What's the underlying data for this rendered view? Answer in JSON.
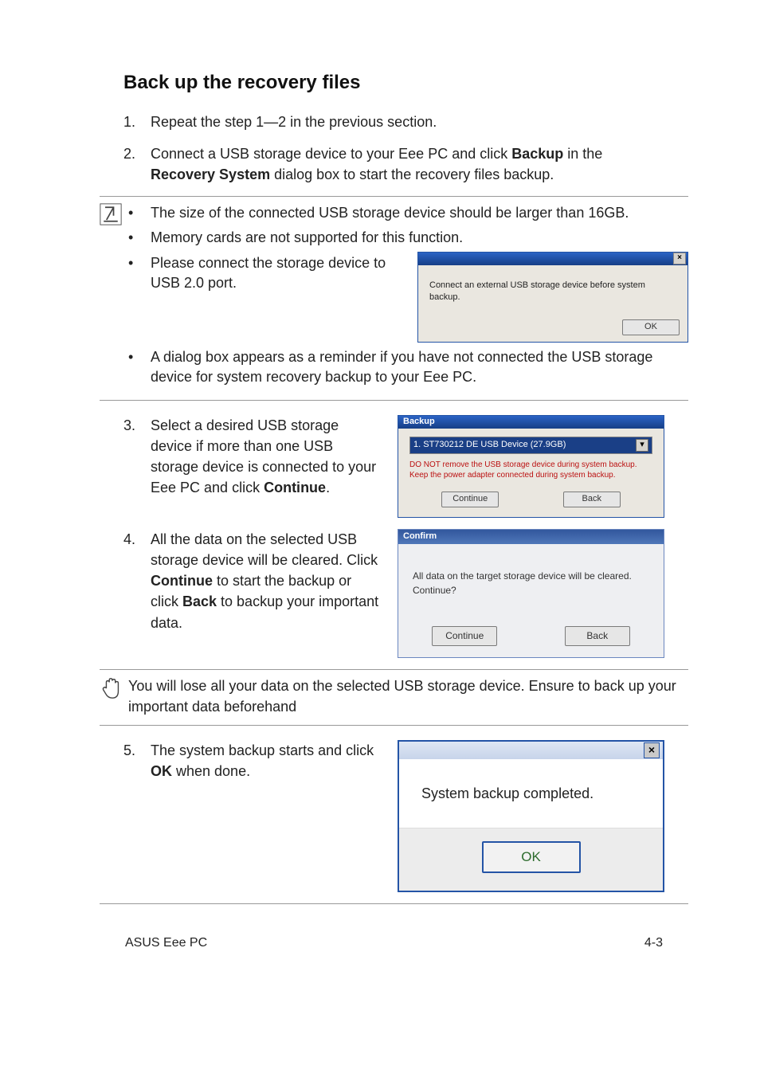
{
  "title": "Back up the recovery files",
  "steps": {
    "s1": {
      "num": "1.",
      "text": "Repeat the step 1—2 in the previous section."
    },
    "s2": {
      "num": "2.",
      "t1": "Connect a USB storage device to your Eee PC and click ",
      "b1": "Backup",
      "t2": " in the ",
      "b2": "Recovery System",
      "t3": " dialog box to start the recovery files backup."
    },
    "s3": {
      "num": "3.",
      "t1": "Select a desired USB storage device if more than one USB storage device is connected to your Eee PC and click ",
      "b1": "Continue",
      "t2": "."
    },
    "s4": {
      "num": "4.",
      "t1": "All the data on the selected USB storage device will be cleared. Click ",
      "b1": "Continue",
      "t2": " to start the backup or click ",
      "b2": "Back",
      "t3": " to backup your important data."
    },
    "s5": {
      "num": "5.",
      "t1": "The system backup starts and click ",
      "b1": "OK",
      "t2": " when done."
    }
  },
  "note1": {
    "b1": "The size of the connected USB storage device should be larger than 16GB.",
    "b2": "Memory cards are not supported for this function.",
    "b3": "Please connect the storage device to USB 2.0 port.",
    "b4": "A dialog box appears as a reminder if you have not connected the USB storage device for system recovery backup to your Eee PC."
  },
  "caution": "You will lose all your data on the selected USB storage device. Ensure to back up your important data beforehand",
  "shotA": {
    "msg": "Connect an external USB storage device before system backup.",
    "ok": "OK",
    "x": "×"
  },
  "shotB": {
    "title": "Backup",
    "device": "1. ST730212 DE USB Device  (27.9GB)",
    "warn": "DO NOT remove the USB storage device during system backup. Keep the power adapter connected during system backup.",
    "continue": "Continue",
    "back": "Back",
    "dd": "▾"
  },
  "shotC": {
    "title": "Confirm",
    "msg1": "All data on the target storage device will be cleared.",
    "msg2": "Continue?",
    "continue": "Continue",
    "back": "Back"
  },
  "shotD": {
    "msg": "System backup completed.",
    "ok": "OK",
    "x": "×"
  },
  "footer": {
    "left": "ASUS Eee PC",
    "right": "4-3"
  },
  "bullet": "•"
}
